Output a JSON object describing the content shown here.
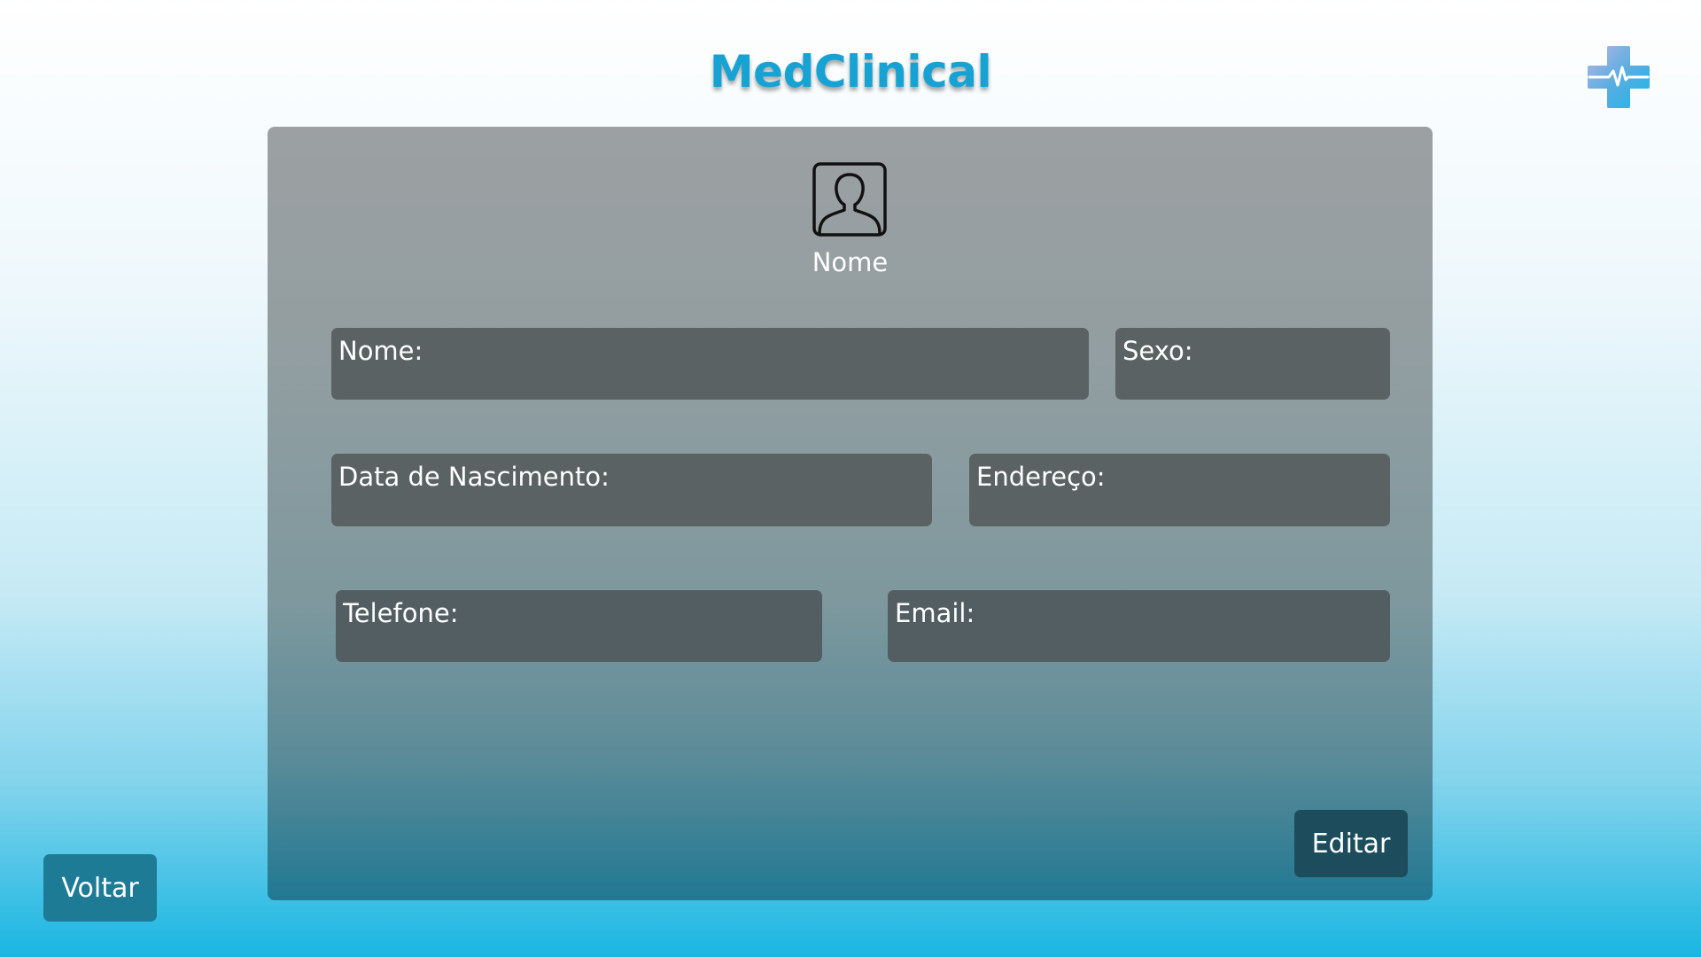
{
  "app": {
    "title": "MedClinical"
  },
  "profile": {
    "name": "Nome",
    "avatar_icon": "user-silhouette-icon"
  },
  "form": {
    "nome_label": "Nome:",
    "sexo_label": "Sexo:",
    "data_nascimento_label": "Data de Nascimento:",
    "endereco_label": "Endereço:",
    "telefone_label": "Telefone:",
    "email_label": "Email:"
  },
  "actions": {
    "editar_label": "Editar",
    "voltar_label": "Voltar"
  },
  "colors": {
    "brand": "#17a2d4",
    "field_bg": "#5b6264",
    "edit_button": "#1d4d5c",
    "back_button": "#1e7b96"
  }
}
